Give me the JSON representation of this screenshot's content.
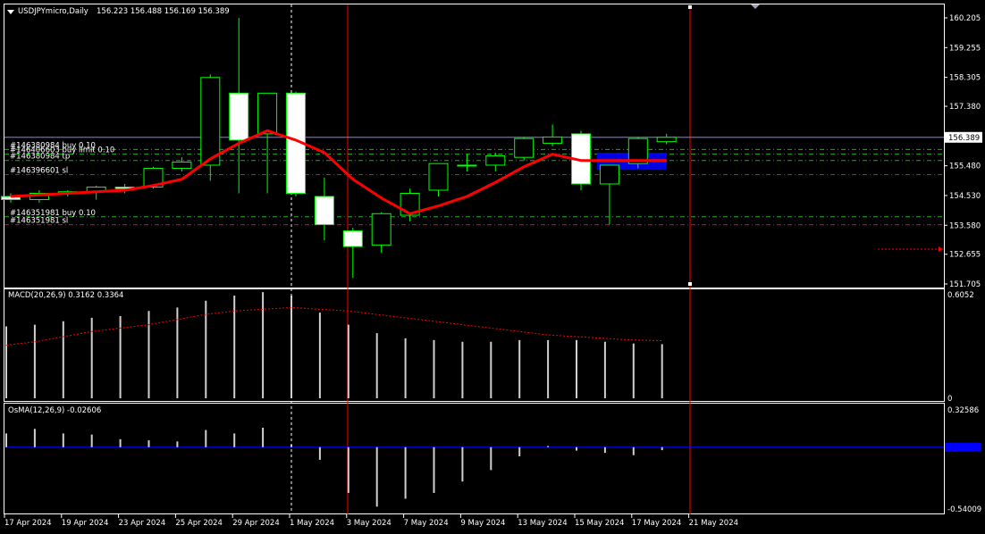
{
  "chart_data": [
    {
      "type": "candlestick",
      "symbol_label": "USDJPYmicro,Daily",
      "ohlc_label": "156.223 156.488 156.169 156.389",
      "current_price": 156.389,
      "ylim": [
        151.705,
        160.205
      ],
      "y_ticks": [
        "160.205",
        "159.255",
        "158.305",
        "157.380",
        "156.389",
        "155.480",
        "154.530",
        "153.580",
        "152.655",
        "151.705"
      ],
      "x_labels": [
        "17 Apr 2024",
        "19 Apr 2024",
        "23 Apr 2024",
        "25 Apr 2024",
        "29 Apr 2024",
        "1 May 2024",
        "3 May 2024",
        "7 May 2024",
        "9 May 2024",
        "13 May 2024",
        "15 May 2024",
        "17 May 2024",
        "21 May 2024"
      ],
      "candles": [
        {
          "o": 154.5,
          "h": 154.6,
          "l": 154.3,
          "c": 154.4
        },
        {
          "o": 154.4,
          "h": 154.7,
          "l": 154.3,
          "c": 154.6
        },
        {
          "o": 154.6,
          "h": 154.7,
          "l": 154.5,
          "c": 154.65
        },
        {
          "o": 154.65,
          "h": 154.85,
          "l": 154.4,
          "c": 154.8
        },
        {
          "o": 154.8,
          "h": 154.9,
          "l": 154.6,
          "c": 154.75
        },
        {
          "o": 154.8,
          "h": 155.45,
          "l": 154.75,
          "c": 155.4
        },
        {
          "o": 155.4,
          "h": 155.75,
          "l": 155.3,
          "c": 155.6
        },
        {
          "o": 155.5,
          "h": 158.4,
          "l": 155.0,
          "c": 158.3
        },
        {
          "o": 157.8,
          "h": 160.2,
          "l": 154.6,
          "c": 156.3
        },
        {
          "o": 156.5,
          "h": 157.8,
          "l": 154.6,
          "c": 157.8
        },
        {
          "o": 157.8,
          "h": 157.85,
          "l": 154.5,
          "c": 154.6
        },
        {
          "o": 154.5,
          "h": 155.1,
          "l": 153.1,
          "c": 153.6
        },
        {
          "o": 153.4,
          "h": 153.5,
          "l": 151.9,
          "c": 152.9
        },
        {
          "o": 152.95,
          "h": 154.0,
          "l": 152.7,
          "c": 153.95
        },
        {
          "o": 153.9,
          "h": 154.75,
          "l": 153.7,
          "c": 154.6
        },
        {
          "o": 154.7,
          "h": 155.55,
          "l": 154.5,
          "c": 155.55
        },
        {
          "o": 155.5,
          "h": 155.85,
          "l": 155.3,
          "c": 155.5
        },
        {
          "o": 155.5,
          "h": 155.9,
          "l": 155.3,
          "c": 155.8
        },
        {
          "o": 155.75,
          "h": 156.4,
          "l": 155.65,
          "c": 156.35
        },
        {
          "o": 156.2,
          "h": 156.8,
          "l": 156.1,
          "c": 156.4
        },
        {
          "o": 156.5,
          "h": 156.6,
          "l": 154.7,
          "c": 154.9
        },
        {
          "o": 154.9,
          "h": 155.45,
          "l": 153.6,
          "c": 155.5
        },
        {
          "o": 155.55,
          "h": 156.4,
          "l": 155.4,
          "c": 156.35
        },
        {
          "o": 156.25,
          "h": 156.5,
          "l": 156.17,
          "c": 156.39
        }
      ],
      "ma_line": [
        154.5,
        154.55,
        154.6,
        154.65,
        154.7,
        154.85,
        155.05,
        155.7,
        156.2,
        156.6,
        156.3,
        155.9,
        155.05,
        154.45,
        153.95,
        154.2,
        154.5,
        154.95,
        155.45,
        155.85,
        155.65,
        155.65,
        155.65,
        155.65
      ],
      "order_lines": [
        {
          "label": "#146380984 buy 0.10",
          "price": 156.0,
          "style": "green"
        },
        {
          "label": "#146380984 tp",
          "price": 155.65,
          "style": "green"
        },
        {
          "label": "#146406603 buy limit 0.10",
          "price": 155.85,
          "style": "green"
        },
        {
          "label": "#146396601 sl",
          "price": 155.2,
          "style": "red"
        },
        {
          "label": "#146351981 buy 0.10",
          "price": 153.85,
          "style": "green"
        },
        {
          "label": "#146351981 sl",
          "price": 153.6,
          "style": "red"
        }
      ],
      "colors": {
        "bull_body": "#000000",
        "bear_body": "#ffffff",
        "candle_line": "#00ff00",
        "ma": "#ff0000",
        "order_buy": "#00c000",
        "order_sl": "#ff0000",
        "current_price": "#8080ff",
        "selection": "#0000ff"
      }
    },
    {
      "type": "bar",
      "label": "MACD(20,26,9) 0.3162 0.3364",
      "ylim": [
        0,
        0.6052
      ],
      "y_ticks": [
        "0.6052",
        "0"
      ],
      "values": [
        0.42,
        0.43,
        0.45,
        0.47,
        0.48,
        0.51,
        0.53,
        0.57,
        0.6,
        0.62,
        0.6,
        0.5,
        0.43,
        0.38,
        0.35,
        0.34,
        0.33,
        0.33,
        0.34,
        0.34,
        0.34,
        0.33,
        0.32,
        0.3162
      ],
      "signal": [
        0.31,
        0.33,
        0.36,
        0.39,
        0.41,
        0.43,
        0.46,
        0.49,
        0.51,
        0.52,
        0.53,
        0.52,
        0.51,
        0.49,
        0.47,
        0.45,
        0.43,
        0.41,
        0.39,
        0.37,
        0.36,
        0.35,
        0.34,
        0.3364
      ]
    },
    {
      "type": "bar",
      "label": "OsMA(12,26,9) -0.02606",
      "ylim": [
        -0.54009,
        0.32586
      ],
      "y_ticks": [
        "0.32586",
        "-0.54009"
      ],
      "values": [
        0.12,
        0.16,
        0.12,
        0.11,
        0.07,
        0.06,
        0.05,
        0.15,
        0.12,
        0.17,
        0.02,
        -0.11,
        -0.4,
        -0.52,
        -0.45,
        -0.4,
        -0.3,
        -0.2,
        -0.08,
        0.01,
        -0.03,
        -0.05,
        -0.07,
        -0.02606
      ]
    }
  ]
}
